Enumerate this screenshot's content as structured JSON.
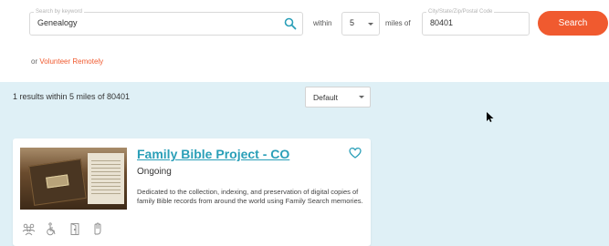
{
  "search": {
    "keyword_label": "Search by keyword",
    "keyword_value": "Genealogy",
    "within_label": "within",
    "distance_value": "5",
    "miles_label": "miles of",
    "location_label": "City/State/Zip/Postal Code",
    "location_value": "80401",
    "search_button": "Search"
  },
  "volunteer": {
    "prefix": "or",
    "link": "Volunteer Remotely"
  },
  "results": {
    "count_text": "1 results within 5 miles of 80401",
    "sort_value": "Default"
  },
  "card": {
    "title": "Family Bible Project - CO",
    "status": "Ongoing",
    "description": "Dedicated to the collection, indexing, and preservation of digital copies of family Bible records from around the world using Family Search memories.",
    "image_label": "Family Genealogy",
    "icons": [
      "group-icon",
      "wheelchair-icon",
      "door-icon",
      "hand-icon"
    ]
  },
  "colors": {
    "accent": "#f05a2f",
    "title": "#2a9fb8",
    "results_bg": "#dff0f6"
  }
}
